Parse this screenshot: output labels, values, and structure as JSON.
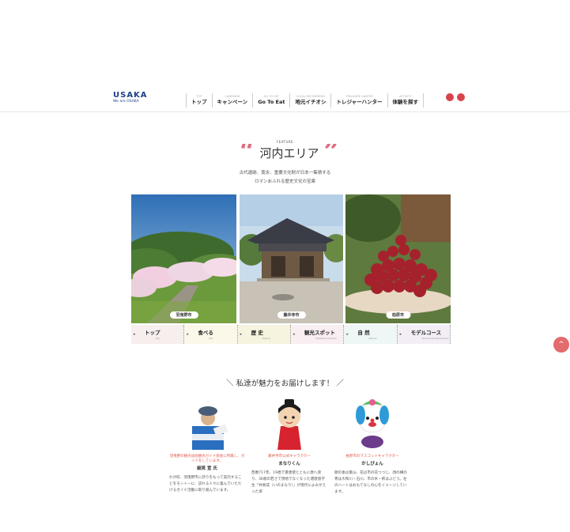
{
  "header": {
    "logo_mark": "USAKA",
    "logo_sub": "We are OSAKA",
    "nav": [
      {
        "en": "TOP",
        "ja": "トップ"
      },
      {
        "en": "CAMPAIGN",
        "ja": "キャンペーン"
      },
      {
        "en": "GO TO EAT",
        "ja": "Go To Eat"
      },
      {
        "en": "LOCAL RECOMMEND",
        "ja": "地元イチオシ"
      },
      {
        "en": "TREASURE HUNTER",
        "ja": "トレジャーハンター"
      },
      {
        "en": "ACTIVITY",
        "ja": "体験を探す"
      }
    ],
    "sns_color": "#d8434e"
  },
  "feature": {
    "label": "FEATURE",
    "title": "河内エリア",
    "lead_line1": "古代遺跡、寛永、重要文化財が日本一集積する",
    "lead_line2": "ロマンあふれる歴史文化の宝庫",
    "quote_open": "“",
    "quote_close": "”",
    "accent_color": "#e06c80"
  },
  "photos": [
    {
      "caption": "羽曳野市",
      "icon": "cherry-blossom-photo"
    },
    {
      "caption": "藤井寺市",
      "icon": "temple-photo"
    },
    {
      "caption": "柏原市",
      "icon": "grapes-photo"
    }
  ],
  "tabs": [
    {
      "ja": "トップ",
      "en": "Top",
      "color": "#f7eeee"
    },
    {
      "ja": "食べる",
      "en": "Eat",
      "color": "#fbf7e9"
    },
    {
      "ja": "歴 史",
      "en": "History",
      "color": "#f6f3df"
    },
    {
      "ja": "観光スポット",
      "en": "Sightseeing Spots",
      "color": "#f9eef1"
    },
    {
      "ja": "自 然",
      "en": "Nature",
      "color": "#eef6f6"
    },
    {
      "ja": "モデルコース",
      "en": "Recommended Routes",
      "color": "#f3eef6"
    }
  ],
  "pagetop": "^",
  "section2": {
    "title": "＼ 私達が魅力をお届けします！ ／",
    "people": [
      {
        "role": "羽曳野の観光協会観光ガイド部会に所属し、ガイドをしています。",
        "name": "細見 宣 氏",
        "desc": "わが町、羽曳野市に誇りをもって案内することをモットーに、訪れる人々に喜んでいただけるガイド活動に取り組んでいます。",
        "icon": "guide-portrait"
      },
      {
        "role": "藤井寺市公式キャラクター",
        "name": "まなりくん",
        "desc": "西暦717年、19歳で遣唐使とともに唐へ渡り、36歳の若さで現地でなくなった遣唐留学生「井真成（いのまなり）」が現代によみがえった姿",
        "icon": "manari-mascot"
      },
      {
        "role": "柏原市のマスコットキャラクター",
        "name": "かしぴょん",
        "desc": "頭の後は葉山、花は市の花つつじ、顔の横の青は大和川・石川、市の木・柿はぶどう。左のハートはおもてなしの心をイメージしています。",
        "icon": "kashipyon-mascot"
      }
    ]
  }
}
